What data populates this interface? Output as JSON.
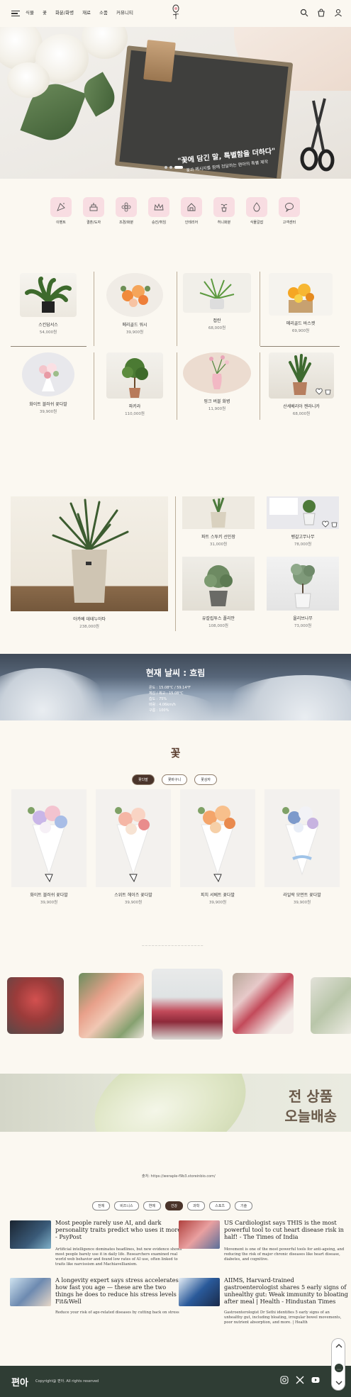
{
  "header": {
    "nav": [
      "식물",
      "꽃",
      "화분/화병",
      "재료",
      "소품",
      "커뮤니티"
    ]
  },
  "hero": {
    "headline": "\"꽃에 담긴 말, 특별함을 더하다\"",
    "subline": "꽃과 메시지를 함께 전달하는 편아의 특별 제작"
  },
  "categories": [
    "이벤트",
    "결혼/도자",
    "조경/화분",
    "승진/취임",
    "인테리어",
    "허니화분",
    "식물갈잡",
    "고객센터"
  ],
  "products_a": [
    {
      "name": "스킨답서스",
      "price": "54,000원"
    },
    {
      "name": "메리골드 워시",
      "price": "39,900원"
    },
    {
      "name": "접란",
      "price": "68,000원"
    },
    {
      "name": "메리골드 바스켓",
      "price": "69,900원"
    },
    {
      "name": "화이트 블러쉬 꽃다발",
      "price": "39,900원"
    },
    {
      "name": "파키라",
      "price": "110,000원"
    },
    {
      "name": "핑크 버블 화병",
      "price": "11,900원"
    },
    {
      "name": "산세베리아 젠라니카",
      "price": "68,000원"
    }
  ],
  "products_b": {
    "big": {
      "name": "아카베 데테누아타",
      "price": "238,000원"
    },
    "small": [
      {
        "name": "파트 스투키 선인장",
        "price": "31,000원"
      },
      {
        "name": "벵갈고무나무",
        "price": "78,000원"
      },
      {
        "name": "유칼립투스 폴리안",
        "price": "108,000원"
      },
      {
        "name": "올리브나무",
        "price": "73,000원"
      }
    ]
  },
  "weather": {
    "title": "현재 날씨 : 흐림",
    "lines": [
      "온도 : 15.08°C / 59.14°F",
      "체감 / 최고 : 15.08°C",
      "습도 : 75%",
      "바람 : 4.06km/h",
      "구름 : 100%"
    ]
  },
  "flowers": {
    "title": "꽃",
    "tabs": [
      "꽃다발",
      "꽃바구니",
      "꽃상자"
    ],
    "items": [
      {
        "name": "화이트 블러쉬 꽃다발",
        "price": "39,900원"
      },
      {
        "name": "스위트 헤이즈 꽃다발",
        "price": "39,900원"
      },
      {
        "name": "피치 서베트 꽃다발",
        "price": "39,900원"
      },
      {
        "name": "라일락 모먼트 꽃다발",
        "price": "39,900원"
      }
    ]
  },
  "carousel": {
    "caption": "— — — — — — — — — — — — — — — — — — —"
  },
  "banner": {
    "line1": "전 상품",
    "line2": "오늘배송"
  },
  "source": {
    "label": "출처: https://weraple-f9b3.storeinbio.com/"
  },
  "news": {
    "tabs": [
      "전체",
      "비즈니스",
      "연예",
      "건강",
      "과학",
      "스포츠",
      "기술"
    ],
    "active_tab": "건강",
    "articles": [
      {
        "title": "Most people rarely use AI, and dark personality traits predict who uses it more - PsyPost",
        "desc": "Artificial intelligence dominates headlines, but new evidence shows most people barely use it in daily life. Researchers examined real world web behavior and found low rates of AI use, often linked to traits like narcissism and Machiavellianism."
      },
      {
        "title": "US Cardiologist says THIS is the most powerful tool to cut heart disease risk in half! - The Times of India",
        "desc": "Movement is one of the most powerful tools for anti-ageing, and reducing the risk of major chronic diseases like heart disease, diabetes, and cognitive."
      },
      {
        "title": "A longevity expert says stress accelerates how fast you age — these are the two things he does to reduce his stress levels - Fit&Well",
        "desc": "Reduce your risk of age-related diseases by cutting back on stress"
      },
      {
        "title": "AIIMS, Harvard-trained gastroenterologist shares 5 early signs of unhealthy gut: Weak immunity to bloating after meal | Health - Hindustan Times",
        "desc": "Gastroenterologist Dr Sethi identifies 5 early signs of an unhealthy gut, including bloating, irregular bowel movements, poor nutrient absorption, and more. | Health"
      }
    ]
  },
  "footer": {
    "logo": "편아",
    "copyright": "Copyright@ 편아. All rights reserved"
  }
}
